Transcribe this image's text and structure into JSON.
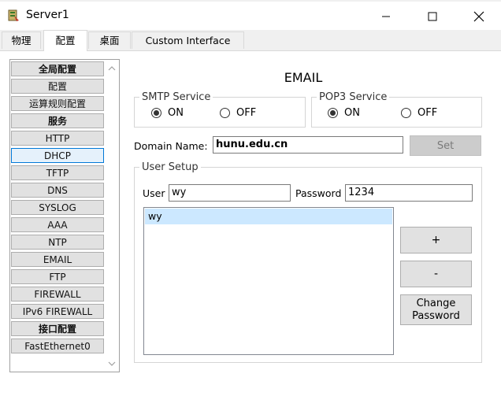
{
  "window": {
    "title": "Server1",
    "minimize_symbol": "—",
    "maximize_symbol": "☐",
    "close_symbol": "✕"
  },
  "tabs": [
    {
      "label": "物理",
      "active": false
    },
    {
      "label": "配置",
      "active": true
    },
    {
      "label": "桌面",
      "active": false
    },
    {
      "label": "Custom Interface",
      "active": false
    }
  ],
  "sidebar": {
    "items": [
      {
        "label": "全局配置",
        "header": true
      },
      {
        "label": "配置"
      },
      {
        "label": "运算规则配置"
      },
      {
        "label": "服务",
        "header": true
      },
      {
        "label": "HTTP"
      },
      {
        "label": "DHCP",
        "selected": true
      },
      {
        "label": "TFTP"
      },
      {
        "label": "DNS"
      },
      {
        "label": "SYSLOG"
      },
      {
        "label": "AAA"
      },
      {
        "label": "NTP"
      },
      {
        "label": "EMAIL"
      },
      {
        "label": "FTP"
      },
      {
        "label": "FIREWALL"
      },
      {
        "label": "IPv6 FIREWALL"
      },
      {
        "label": "接口配置",
        "header": true
      },
      {
        "label": "FastEthernet0"
      }
    ]
  },
  "main": {
    "title": "EMAIL",
    "smtp": {
      "legend": "SMTP Service",
      "on_label": "ON",
      "off_label": "OFF",
      "selected": "ON"
    },
    "pop3": {
      "legend": "POP3 Service",
      "on_label": "ON",
      "off_label": "OFF",
      "selected": "ON"
    },
    "domain": {
      "label": "Domain Name:",
      "value": "hunu.edu.cn",
      "set_label": "Set"
    },
    "user_setup": {
      "legend": "User Setup",
      "user_label": "User",
      "user_value": "wy",
      "password_label": "Password",
      "password_value": "1234",
      "users": [
        "wy"
      ],
      "add_label": "+",
      "remove_label": "-",
      "change_password_line1": "Change",
      "change_password_line2": "Password"
    }
  },
  "colors": {
    "selected_list_bg": "#cce8ff",
    "selected_sidebar_border": "#0078d7",
    "button_bg": "#e1e1e1",
    "disabled_button_bg": "#cccccc"
  }
}
